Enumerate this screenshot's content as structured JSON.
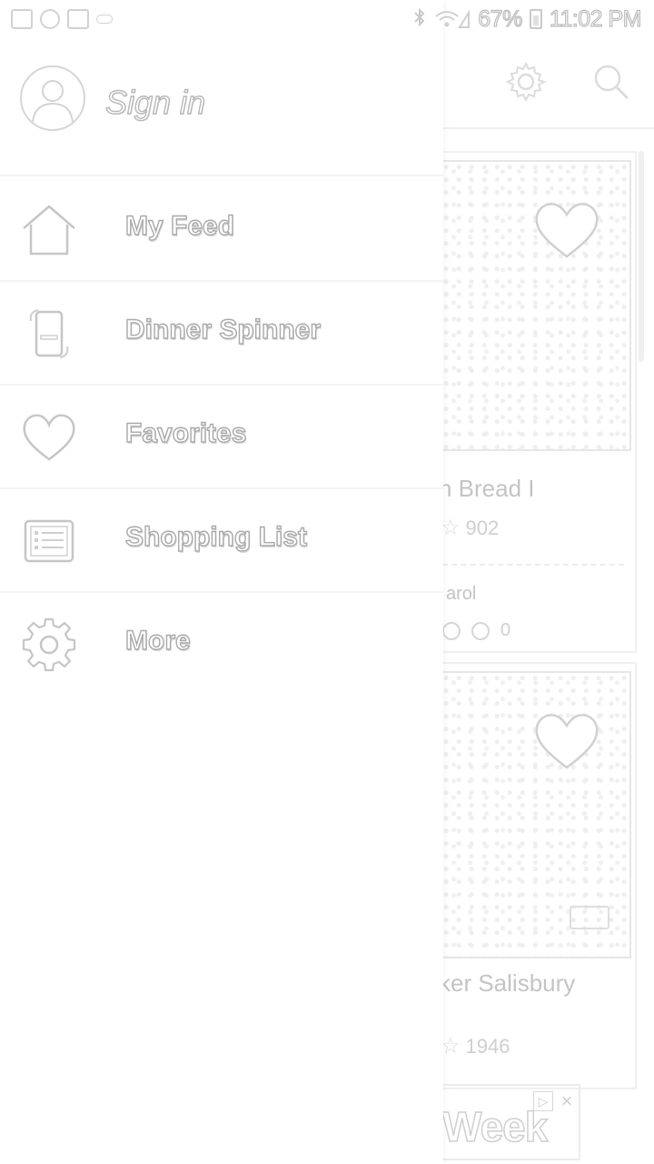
{
  "status_bar": {
    "battery_text": "67%",
    "time": "11:02 PM",
    "left_icons": [
      "photo-notification-icon",
      "pinwheel-notification-icon",
      "gmail-notification-icon",
      "voicemail-icon"
    ],
    "right_icons": [
      "bluetooth-icon",
      "wifi-icon",
      "signal-icon",
      "battery-icon"
    ]
  },
  "drawer": {
    "header": {
      "sign_in_label": "Sign in",
      "avatar_icon": "avatar-placeholder-icon"
    },
    "items": [
      {
        "label": "My Feed",
        "icon": "home-icon"
      },
      {
        "label": "Dinner Spinner",
        "icon": "phone-spinner-icon"
      },
      {
        "label": "Favorites",
        "icon": "heart-icon"
      },
      {
        "label": "Shopping List",
        "icon": "list-icon"
      },
      {
        "label": "More",
        "icon": "gear-icon"
      }
    ]
  },
  "background": {
    "toolbar_icons": [
      "gear-icon",
      "search-icon"
    ],
    "cards": [
      {
        "title": "n Bread I",
        "rating_count": "902",
        "author": "arol",
        "stats_value": "0"
      },
      {
        "title": "ker Salisbury",
        "rating_count": "1946"
      }
    ],
    "ad": {
      "text": "Week"
    }
  }
}
